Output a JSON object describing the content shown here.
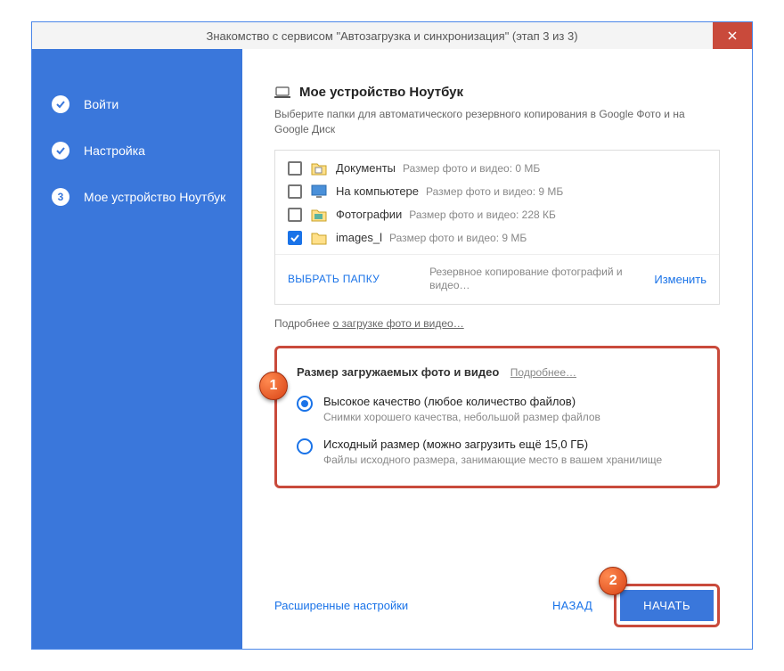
{
  "titlebar": {
    "text": "Знакомство с сервисом \"Автозагрузка и синхронизация\" (этап 3 из 3)"
  },
  "sidebar": {
    "steps": [
      {
        "label": "Войти"
      },
      {
        "label": "Настройка"
      },
      {
        "label": "Мое устройство Ноутбук"
      }
    ]
  },
  "main": {
    "device_title": "Мое устройство Ноутбук",
    "device_sub": "Выберите папки для автоматического резервного копирования в Google Фото и на Google Диск",
    "folders": [
      {
        "name": "Документы",
        "meta": "Размер фото и видео: 0 МБ",
        "checked": false,
        "icon": "docs"
      },
      {
        "name": "На компьютере",
        "meta": "Размер фото и видео: 9 МБ",
        "checked": false,
        "icon": "desktop"
      },
      {
        "name": "Фотографии",
        "meta": "Размер фото и видео: 228 КБ",
        "checked": false,
        "icon": "photos"
      },
      {
        "name": "images_l",
        "meta": "Размер фото и видео: 9 МБ",
        "checked": true,
        "icon": "folder"
      }
    ],
    "choose_folder": "ВЫБРАТЬ ПАПКУ",
    "backup_note": "Резервное копирование фотографий и видео…",
    "change": "Изменить",
    "more_about_prefix": "Подробнее ",
    "more_about_link": "о загрузке фото и видео…"
  },
  "quality": {
    "title": "Размер загружаемых фото и видео",
    "more": "Подробнее…",
    "options": [
      {
        "label": "Высокое качество (любое количество файлов)",
        "desc": "Снимки хорошего качества, небольшой размер файлов",
        "selected": true
      },
      {
        "label": "Исходный размер (можно загрузить ещё 15,0 ГБ)",
        "desc": "Файлы исходного размера, занимающие место в вашем хранилище",
        "selected": false
      }
    ]
  },
  "footer": {
    "advanced": "Расширенные настройки",
    "back": "НАЗАД",
    "start": "НАЧАТЬ"
  },
  "markers": {
    "one": "1",
    "two": "2"
  }
}
